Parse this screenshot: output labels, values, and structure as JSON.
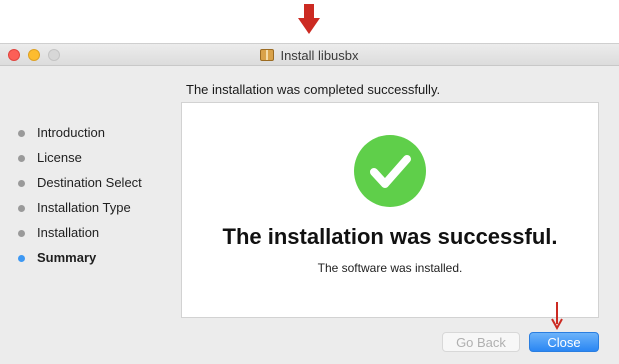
{
  "window": {
    "title": "Install libusbx",
    "title_icon": "package-icon",
    "traffic_lights": [
      "close",
      "minimize",
      "zoom"
    ]
  },
  "heading": "The installation was completed successfully.",
  "sidebar": {
    "steps": [
      {
        "label": "Introduction",
        "active": false
      },
      {
        "label": "License",
        "active": false
      },
      {
        "label": "Destination Select",
        "active": false
      },
      {
        "label": "Installation Type",
        "active": false
      },
      {
        "label": "Installation",
        "active": false
      },
      {
        "label": "Summary",
        "active": true
      }
    ]
  },
  "content": {
    "icon": "checkmark-icon",
    "success_title": "The installation was successful.",
    "success_subtitle": "The software was installed."
  },
  "buttons": {
    "go_back": "Go Back",
    "close": "Close"
  },
  "colors": {
    "success_green": "#5fcf4a",
    "active_dot": "#3d98f3",
    "primary_button": "#2a86f3",
    "annotation_arrow": "#cc2a22"
  }
}
